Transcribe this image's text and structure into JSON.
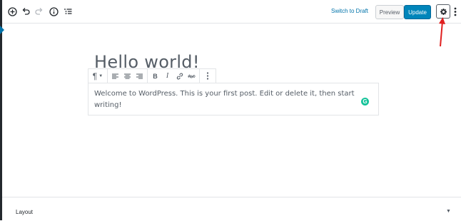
{
  "header": {
    "switch_to_draft": "Switch to Draft",
    "preview_label": "Preview",
    "update_label": "Update"
  },
  "post": {
    "title": "Hello world!",
    "paragraph": "Welcome to WordPress. This is your first post. Edit or delete it, then start writing!"
  },
  "grammarly": {
    "letter": "G",
    "color": "#15c39a"
  },
  "block_toolbar": {
    "paragraph_symbol": "¶",
    "bold": "B",
    "italic": "I"
  },
  "footer": {
    "layout_label": "Layout"
  },
  "colors": {
    "accent": "#0085ba",
    "link": "#0073aa",
    "annotation_arrow": "#e02020"
  },
  "icons": [
    "add-block-icon",
    "undo-icon",
    "redo-icon",
    "info-icon",
    "outline-icon",
    "gear-icon",
    "more-vertical-icon",
    "paragraph-icon",
    "align-left-icon",
    "align-center-icon",
    "align-right-icon",
    "bold-icon",
    "italic-icon",
    "link-icon",
    "strikethrough-icon",
    "grammarly-icon",
    "chevron-down-icon"
  ]
}
